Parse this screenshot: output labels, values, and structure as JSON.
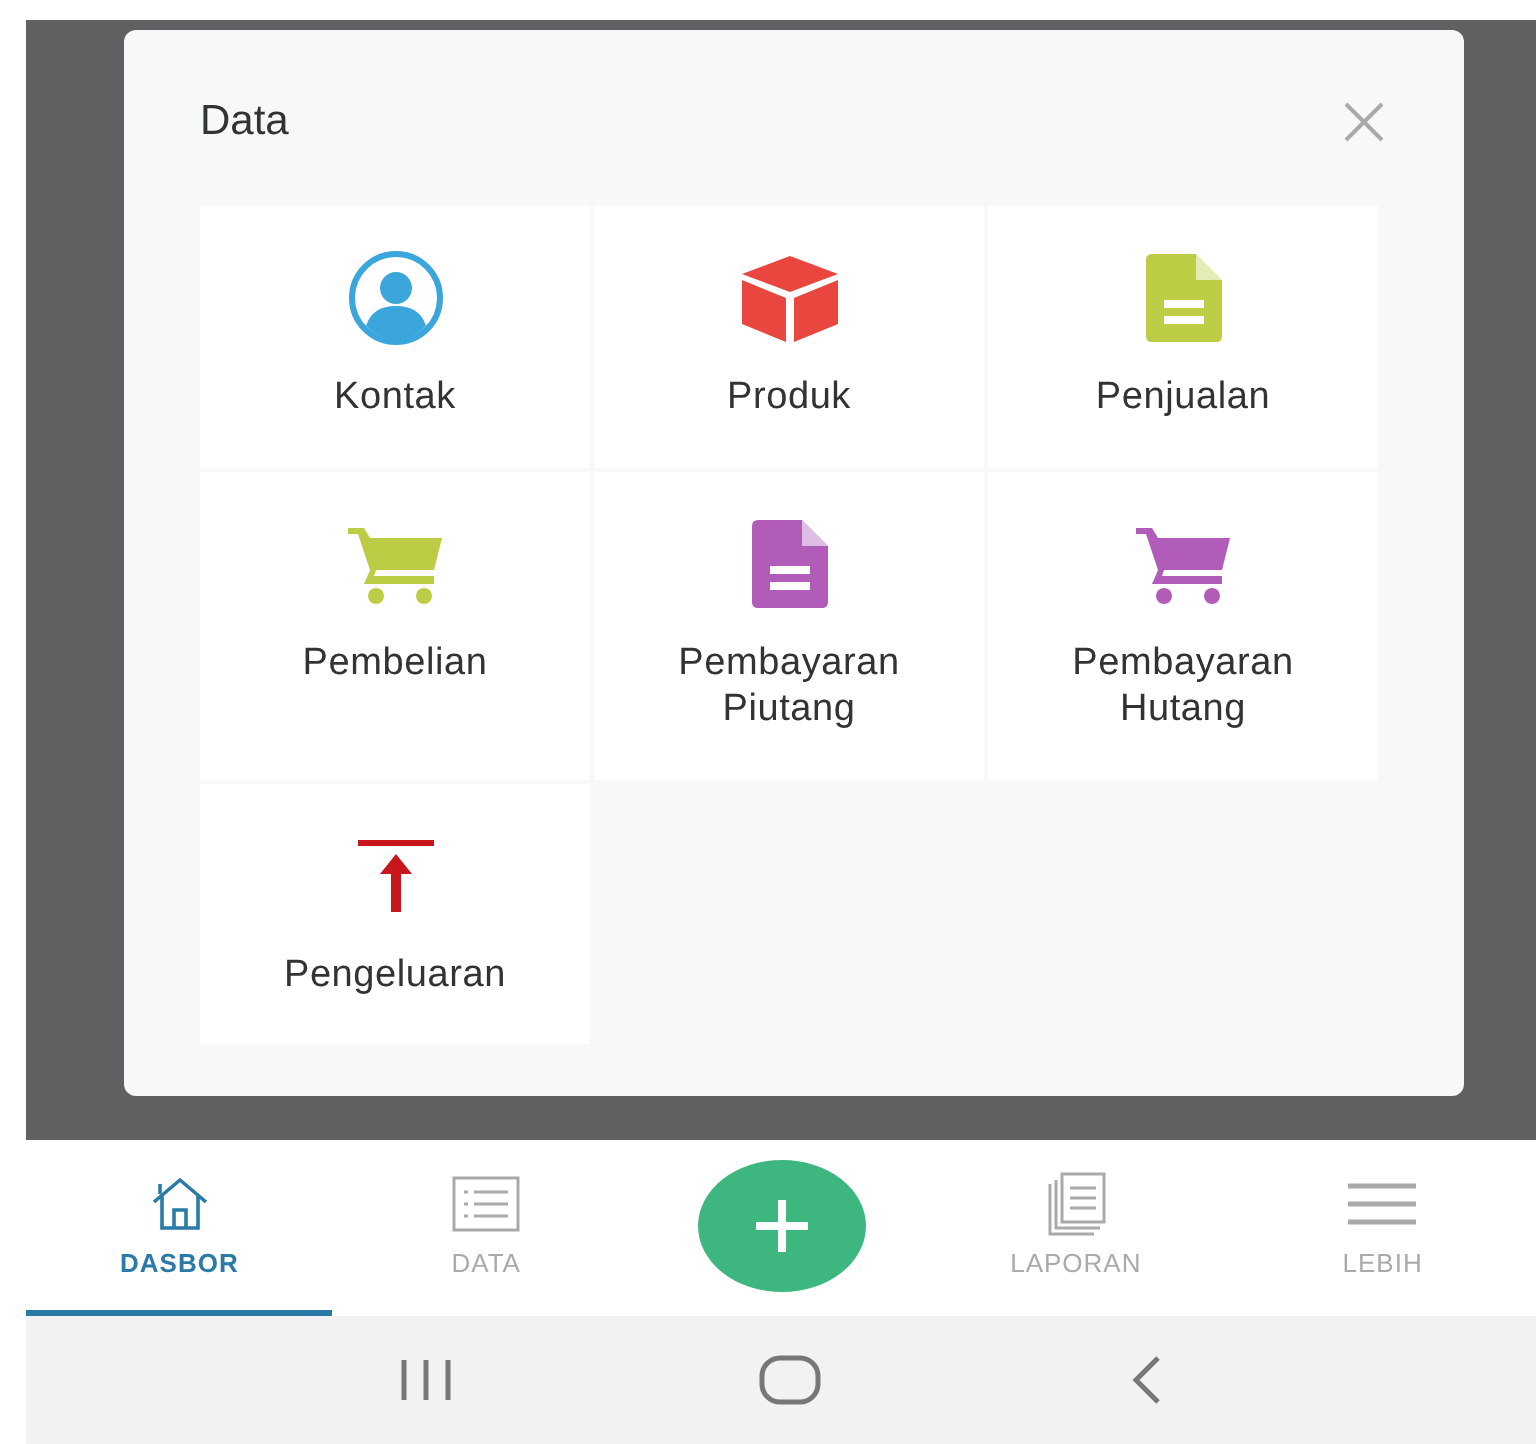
{
  "dialog": {
    "title": "Data",
    "items": [
      {
        "label": "Kontak",
        "kind": "person",
        "color": "#3aa6dc"
      },
      {
        "label": "Produk",
        "kind": "box",
        "color": "#e8463f"
      },
      {
        "label": "Penjualan",
        "kind": "document",
        "color": "#bccc45"
      },
      {
        "label": "Pembelian",
        "kind": "cart",
        "color": "#bccc45"
      },
      {
        "label": "Pembayaran Piutang",
        "kind": "document",
        "color": "#b05cb8"
      },
      {
        "label": "Pembayaran Hutang",
        "kind": "cart",
        "color": "#b05cb8"
      },
      {
        "label": "Pengeluaran",
        "kind": "upload",
        "color": "#c8161d"
      }
    ]
  },
  "bottom_nav": {
    "tabs": [
      {
        "label": "DASBOR",
        "selected": true
      },
      {
        "label": "DATA",
        "selected": false
      },
      {
        "label": "LAPORAN",
        "selected": false
      },
      {
        "label": "LEBIH",
        "selected": false
      }
    ]
  }
}
